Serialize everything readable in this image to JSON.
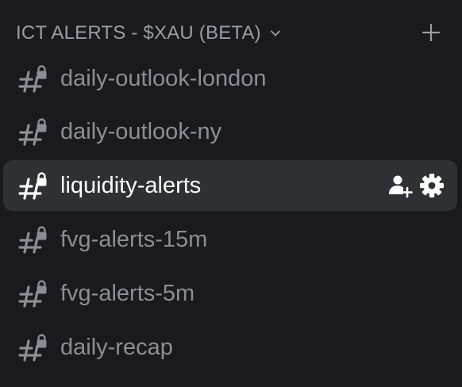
{
  "category": {
    "title": "ICT ALERTS - $XAU (BETA)",
    "collapsed": false
  },
  "channels": [
    {
      "name": "daily-outlook-london",
      "private": true,
      "selected": false
    },
    {
      "name": "daily-outlook-ny",
      "private": true,
      "selected": false
    },
    {
      "name": "liquidity-alerts",
      "private": true,
      "selected": true
    },
    {
      "name": "fvg-alerts-15m",
      "private": true,
      "selected": false
    },
    {
      "name": "fvg-alerts-5m",
      "private": true,
      "selected": false
    },
    {
      "name": "daily-recap",
      "private": true,
      "selected": false
    }
  ],
  "icons": {
    "channel": "hashtag-lock-icon",
    "add": "plus-icon",
    "invite": "add-member-icon",
    "settings": "gear-icon",
    "chevron": "chevron-down-icon"
  },
  "colors": {
    "background": "#1a1a1e",
    "selected_row": "#2f3034",
    "text_muted": "#8d8e95",
    "text_active": "#ffffff",
    "category_text": "#9b9ca3"
  }
}
